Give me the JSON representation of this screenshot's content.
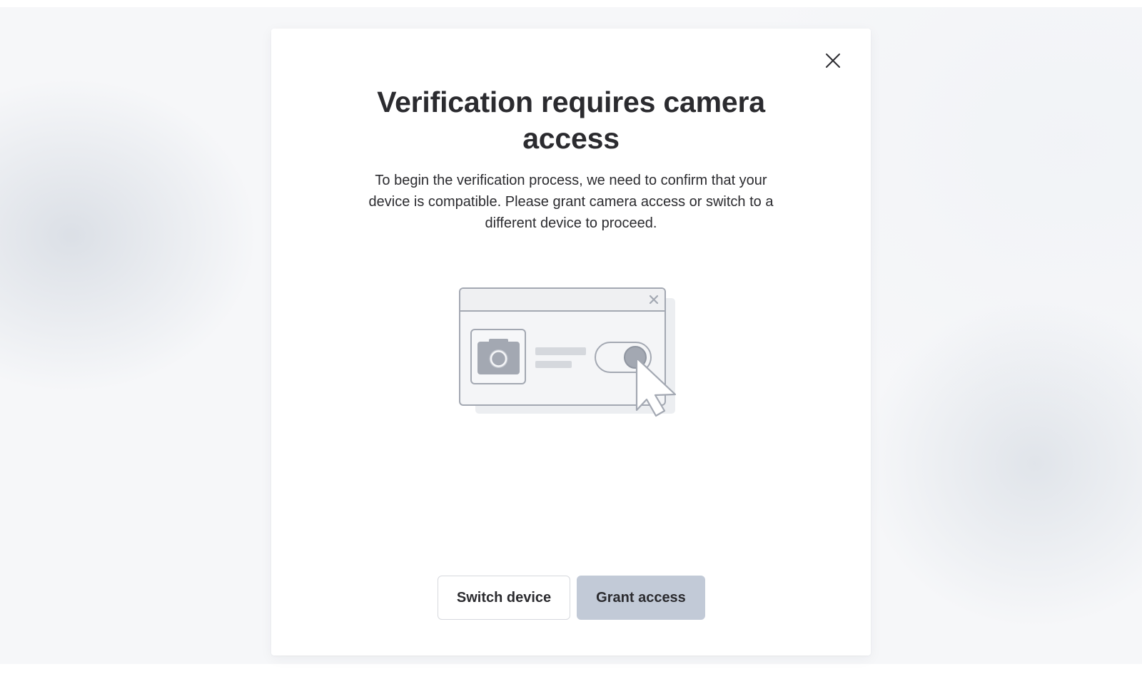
{
  "modal": {
    "title": "Verification requires camera access",
    "description": "To begin the verification process, we need to confirm that your device is compatible. Please grant camera access or switch to a different device to proceed.",
    "close_icon": "close-icon",
    "illustration_icons": [
      "browser-window-icon",
      "camera-icon",
      "toggle-icon",
      "cursor-icon"
    ]
  },
  "actions": {
    "switch_label": "Switch device",
    "grant_label": "Grant access"
  },
  "colors": {
    "primary_button_bg": "#c2cad7",
    "text": "#2b2b2f",
    "illustration_stroke": "#a3a8b2",
    "illustration_fill": "#f3f4f6"
  }
}
